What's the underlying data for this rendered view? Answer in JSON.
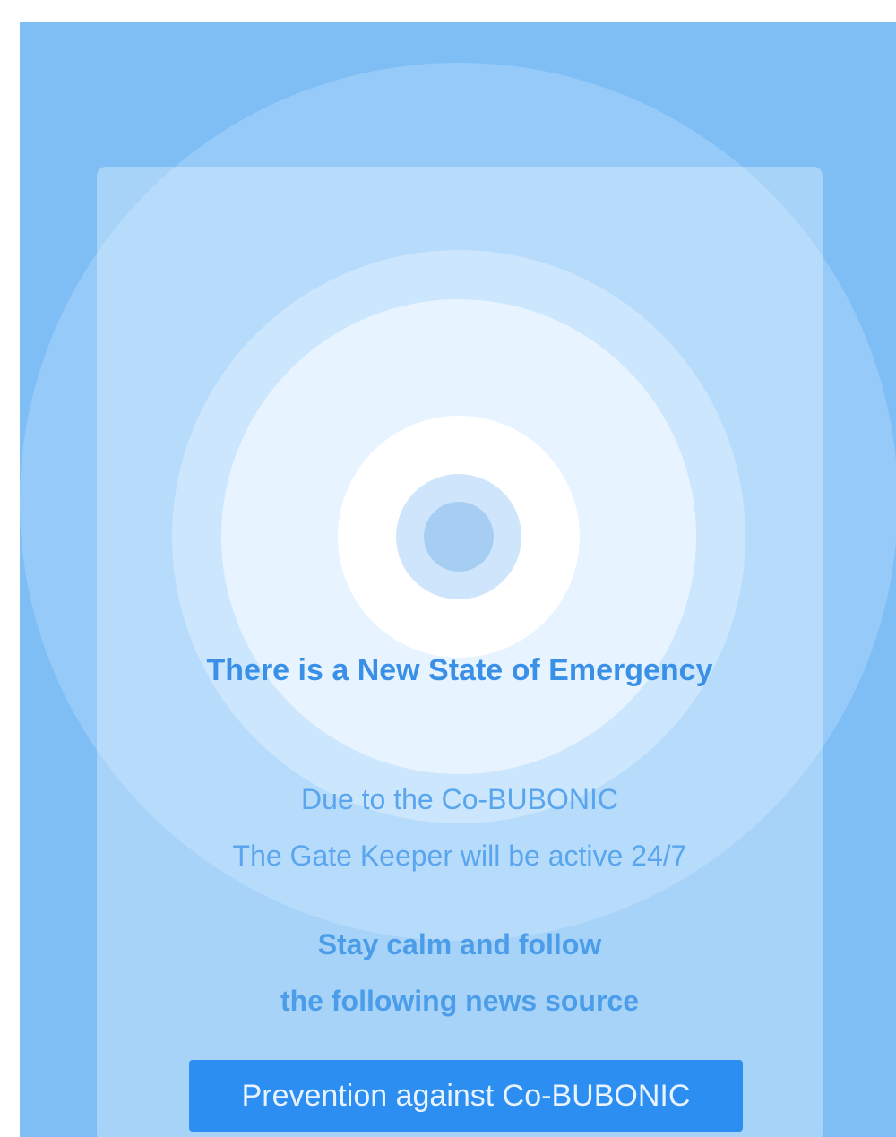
{
  "alert": {
    "headline": "There is a New State of Emergency",
    "message_line_1": "Due to the Co-BUBONIC",
    "message_line_2": "The Gate Keeper will be active 24/7",
    "instruction_line_1": "Stay calm and follow",
    "instruction_line_2": "the following news source",
    "cta_label": "Prevention against Co-BUBONIC"
  },
  "colors": {
    "background": "#7fbef5",
    "accent": "#2b8ef0",
    "text": "#3a90e6"
  },
  "icons": {
    "center": "radar-pulse-icon"
  }
}
